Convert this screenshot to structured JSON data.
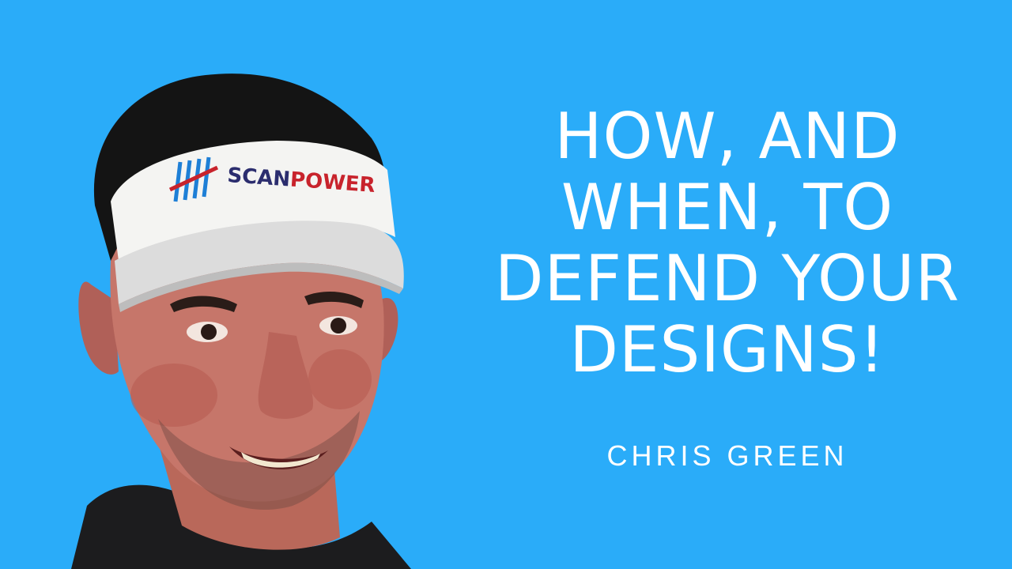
{
  "background_color": "#2aacf9",
  "text_color": "#ffffff",
  "title_lines": [
    "HOW, AND",
    "WHEN, TO",
    "DEFEND YOUR",
    "DESIGNS!"
  ],
  "author": "CHRIS GREEN",
  "visor_logo_text": "SCANPOWER",
  "visor_logo_colors": {
    "scan": "#2b2d6e",
    "power": "#c8232c",
    "mark_blue": "#1e7fd6",
    "mark_red": "#c8232c"
  }
}
